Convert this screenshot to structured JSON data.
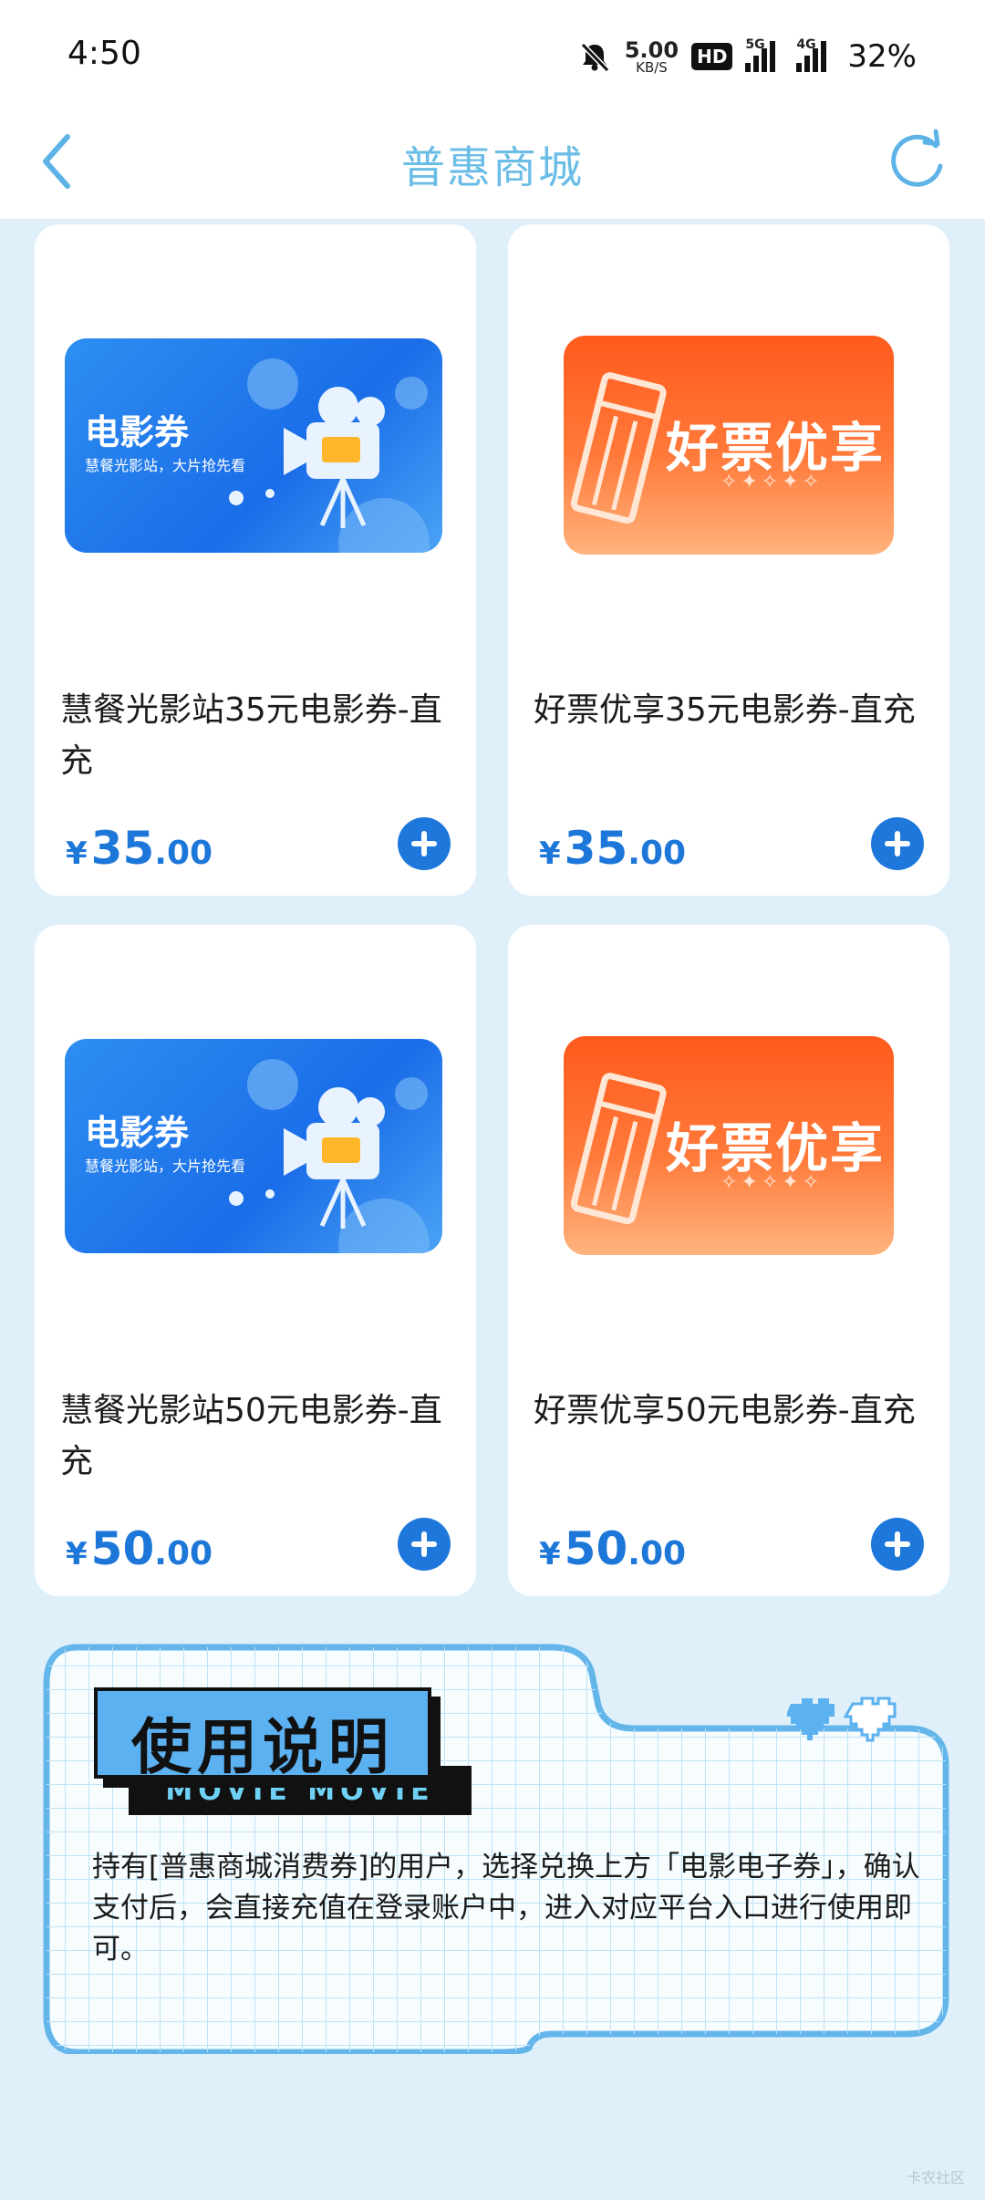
{
  "status_bar": {
    "time": "4:50",
    "net_speed_value": "5.00",
    "net_speed_unit": "KB/S",
    "hd_label": "HD",
    "signal1_tag": "5G",
    "signal2_tag": "4G",
    "battery": "32%"
  },
  "header": {
    "title": "普惠商城"
  },
  "products": [
    {
      "image_title": "电影券",
      "image_subtitle": "慧餐光影站，大片抢先看",
      "name": "慧餐光影站35元电影券-直充",
      "currency": "¥",
      "price_int": "35",
      "price_dec": ".00"
    },
    {
      "image_title": "好票优享",
      "image_stars": "✧✦✧✦✧",
      "name": "好票优享35元电影券-直充",
      "currency": "¥",
      "price_int": "35",
      "price_dec": ".00"
    },
    {
      "image_title": "电影券",
      "image_subtitle": "慧餐光影站，大片抢先看",
      "name": "慧餐光影站50元电影券-直充",
      "currency": "¥",
      "price_int": "50",
      "price_dec": ".00"
    },
    {
      "image_title": "好票优享",
      "image_stars": "✧✦✧✦✧",
      "name": "好票优享50元电影券-直充",
      "currency": "¥",
      "price_int": "50",
      "price_dec": ".00"
    }
  ],
  "instructions": {
    "title": "使用说明",
    "subtitle": "MOVIE MOVIE",
    "text": "持有[普惠商城消费券]的用户，选择兑换上方「电影电子券」，确认支付后，会直接充值在登录账户中，进入对应平台入口进行使用即可。"
  },
  "watermark": "卡农社区",
  "colors": {
    "accent": "#1e78dc",
    "title": "#6bbde6",
    "background": "#dff0fb",
    "voucher_blue": "#1a6de8",
    "voucher_orange": "#ff5a1c"
  }
}
